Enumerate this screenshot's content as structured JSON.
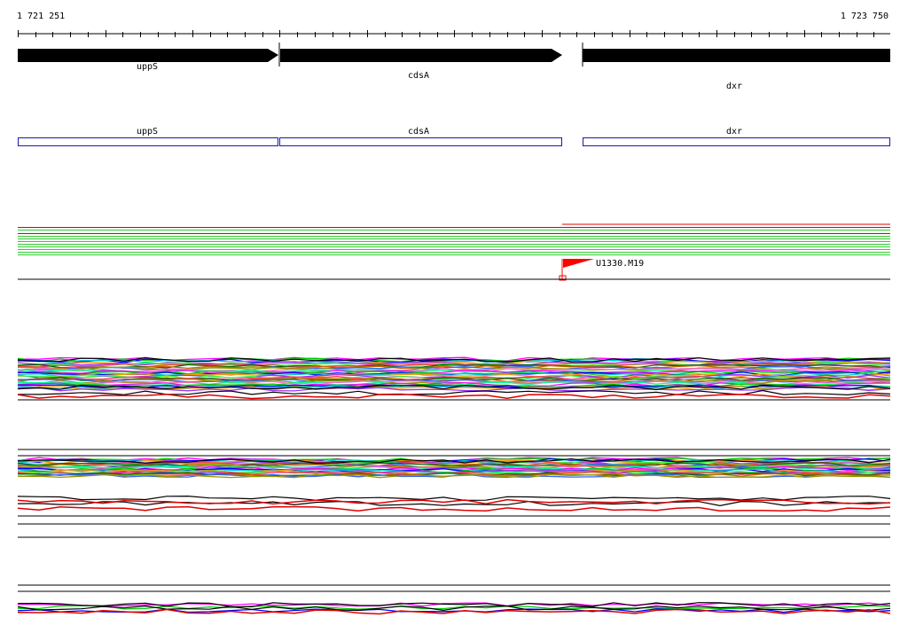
{
  "ruler": {
    "start_label": "1 721 251",
    "end_label": "1 723 750"
  },
  "genes": [
    {
      "name": "uppS",
      "strand": "+"
    },
    {
      "name": "cdsA",
      "strand": "+"
    },
    {
      "name": "dxr",
      "strand": "+"
    }
  ],
  "marker": {
    "label": "U1330.M19",
    "flag_color": "#ff0000"
  },
  "colors": {
    "gene_arrow": "#000000",
    "gene_box_border": "#1a1aa6",
    "track_red": "#e00000",
    "track_green": "#33cc33"
  }
}
